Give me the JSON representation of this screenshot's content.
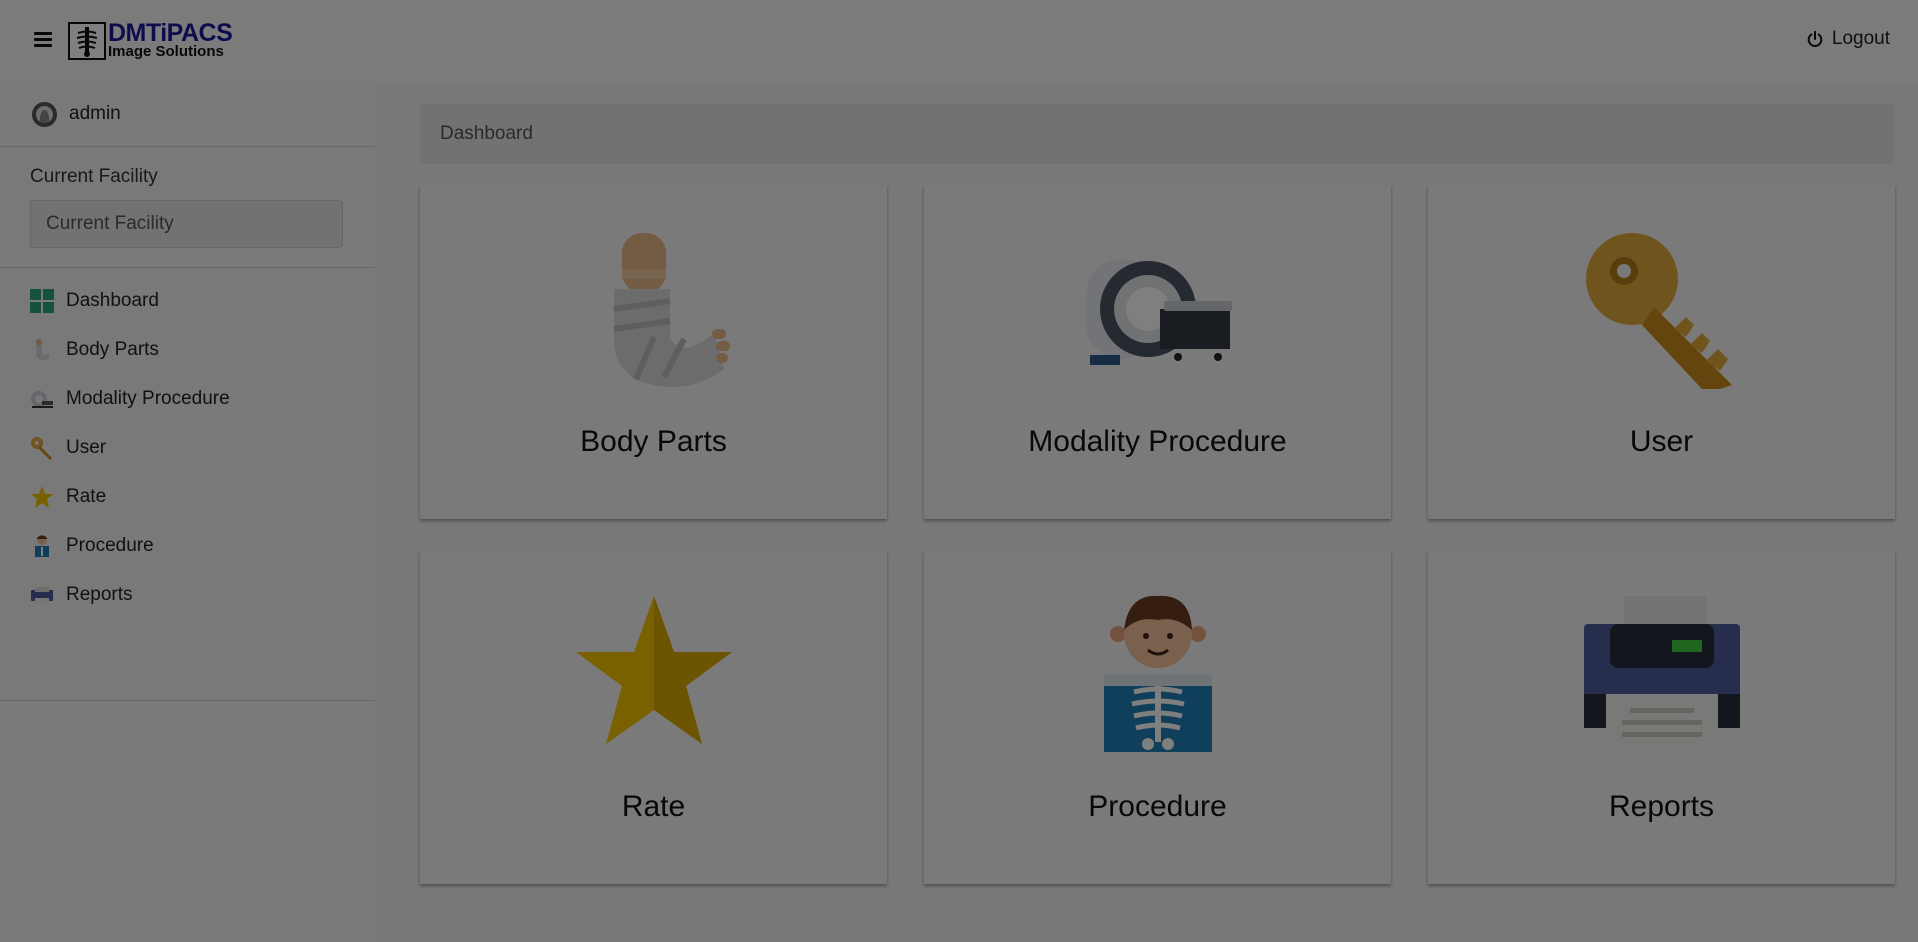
{
  "header": {
    "logo_title": "DMTiPACS",
    "logo_subtitle": "Image Solutions",
    "logout_label": "Logout"
  },
  "sidebar": {
    "username": "admin",
    "facility_label": "Current Facility",
    "facility_placeholder": "Current Facility",
    "items": [
      {
        "label": "Dashboard",
        "icon": "dashboard-grid-icon"
      },
      {
        "label": "Body Parts",
        "icon": "bandaged-arm-icon"
      },
      {
        "label": "Modality Procedure",
        "icon": "ct-scanner-icon"
      },
      {
        "label": "User",
        "icon": "key-icon"
      },
      {
        "label": "Rate",
        "icon": "star-icon"
      },
      {
        "label": "Procedure",
        "icon": "xray-patient-icon"
      },
      {
        "label": "Reports",
        "icon": "printer-icon"
      }
    ]
  },
  "main": {
    "breadcrumb": "Dashboard",
    "cards": [
      {
        "label": "Body Parts",
        "icon": "bandaged-arm-icon"
      },
      {
        "label": "Modality Procedure",
        "icon": "ct-scanner-icon"
      },
      {
        "label": "User",
        "icon": "key-icon"
      },
      {
        "label": "Rate",
        "icon": "star-icon"
      },
      {
        "label": "Procedure",
        "icon": "xray-patient-icon"
      },
      {
        "label": "Reports",
        "icon": "printer-icon"
      }
    ]
  },
  "colors": {
    "overlay": "#000000",
    "logo_blue": "#1a1a9a",
    "key_gold": "#e0a93a",
    "star_gold": "#f2c200",
    "dashboard_green": "#2aa57a"
  }
}
